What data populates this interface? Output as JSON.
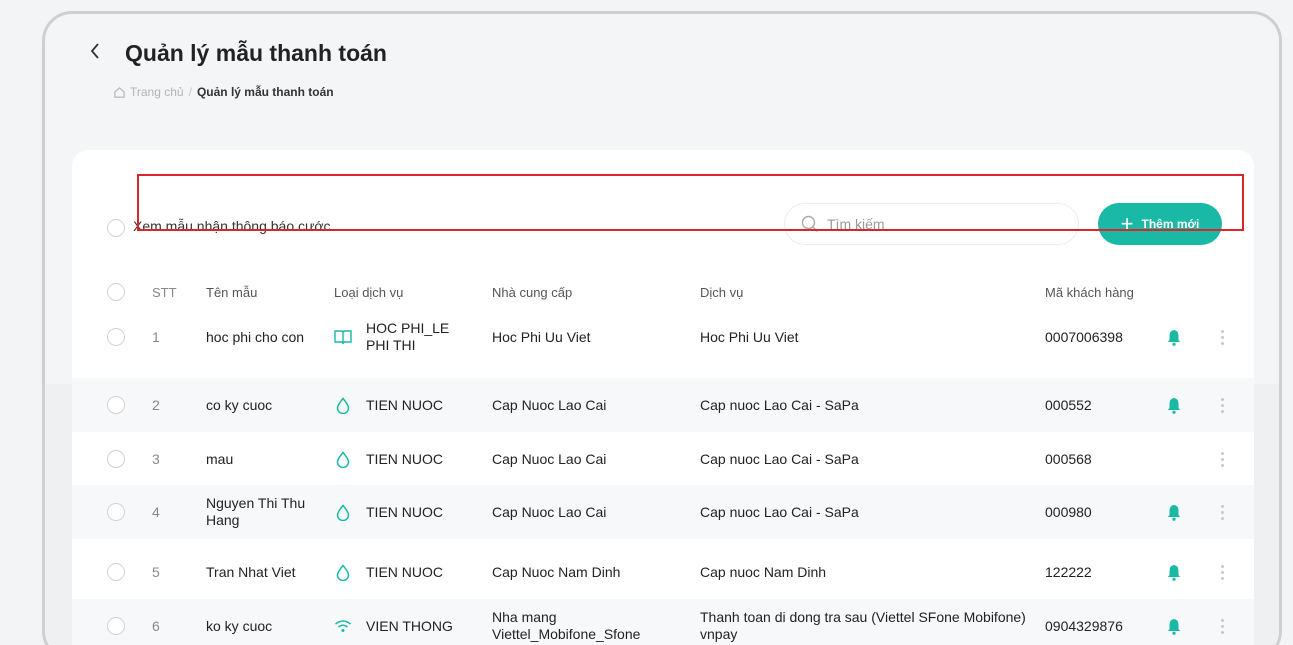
{
  "header": {
    "title": "Quản lý mẫu thanh toán",
    "breadcrumb": {
      "home": "Trang chủ",
      "separator": "/",
      "current": "Quản lý mẫu thanh toán"
    }
  },
  "toolbar": {
    "notice_label": "Xem mẫu nhận thông báo cước",
    "search_placeholder": "Tìm kiếm",
    "add_label": "Thêm mới"
  },
  "table": {
    "headers": [
      "STT",
      "Tên mẫu",
      "Loại dịch vụ",
      "Nhà cung cấp",
      "Dịch vụ",
      "Mã khách hàng"
    ],
    "rows": [
      {
        "stt": "1",
        "name": "hoc phi cho con",
        "type": "HOC PHI_LE PHI THI",
        "type_icon": "book-icon",
        "provider": "Hoc Phi Uu Viet",
        "service": "Hoc Phi Uu Viet",
        "customer_code": "0007006398",
        "bell": true
      },
      {
        "stt": "2",
        "name": "co ky cuoc",
        "type": "TIEN NUOC",
        "type_icon": "water-drop-icon",
        "provider": "Cap Nuoc Lao Cai",
        "service": "Cap nuoc Lao Cai - SaPa",
        "customer_code": "000552",
        "bell": true
      },
      {
        "stt": "3",
        "name": "mau",
        "type": "TIEN NUOC",
        "type_icon": "water-drop-icon",
        "provider": "Cap Nuoc Lao Cai",
        "service": "Cap nuoc Lao Cai - SaPa",
        "customer_code": "000568",
        "bell": false
      },
      {
        "stt": "4",
        "name": "Nguyen Thi Thu Hang",
        "type": "TIEN NUOC",
        "type_icon": "water-drop-icon",
        "provider": "Cap Nuoc Lao Cai",
        "service": "Cap nuoc Lao Cai - SaPa",
        "customer_code": "000980",
        "bell": true
      },
      {
        "stt": "5",
        "name": "Tran Nhat Viet",
        "type": "TIEN NUOC",
        "type_icon": "water-drop-icon",
        "provider": "Cap Nuoc Nam Dinh",
        "service": "Cap nuoc Nam Dinh",
        "customer_code": "122222",
        "bell": true
      },
      {
        "stt": "6",
        "name": "ko ky cuoc",
        "type": "VIEN THONG",
        "type_icon": "wifi-icon",
        "provider": "Nha mang Viettel_Mobifone_Sfone",
        "service": "Thanh toan di dong tra sau (Viettel SFone Mobifone) vnpay",
        "customer_code": "0904329876",
        "bell": true
      }
    ]
  },
  "colors": {
    "accent": "#19b9a5",
    "highlight_border": "#d9262b",
    "bell": "#19b9a5"
  }
}
